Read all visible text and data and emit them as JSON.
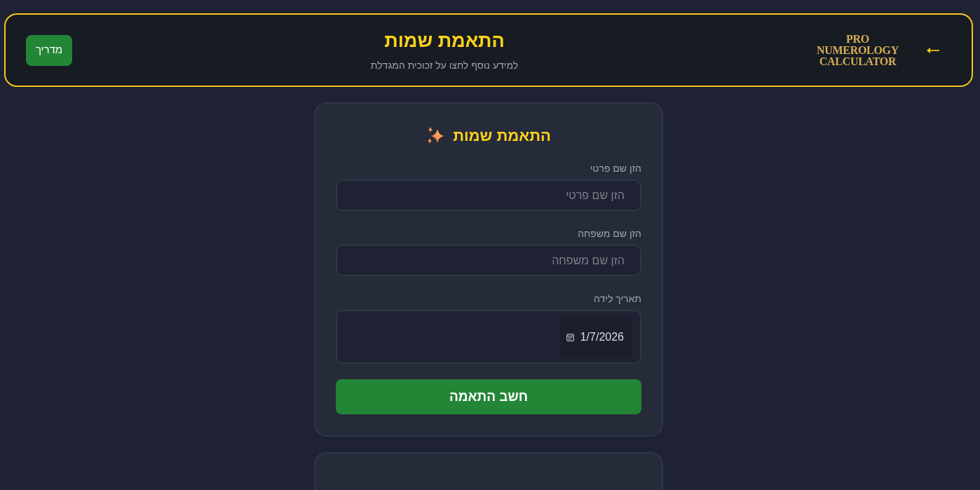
{
  "header": {
    "logo": [
      "PRO",
      "NUMEROLOGY",
      "CALCULATOR"
    ],
    "title": "התאמת שמות",
    "subtitle": "למידע נוסף לחצו על זכוכית המגדלת",
    "guide_button": "מדריך"
  },
  "form": {
    "title": "התאמת שמות",
    "fields": [
      {
        "kind": "text",
        "label": "הזן שם פרטי",
        "placeholder": "הזן שם פרטי"
      },
      {
        "kind": "text",
        "label": "הזן שם משפחה",
        "placeholder": "הזן שם משפחה"
      },
      {
        "kind": "date",
        "label": "תאריך לידה",
        "value": "1/7/2026"
      }
    ],
    "submit_button": "חשב התאמה"
  }
}
